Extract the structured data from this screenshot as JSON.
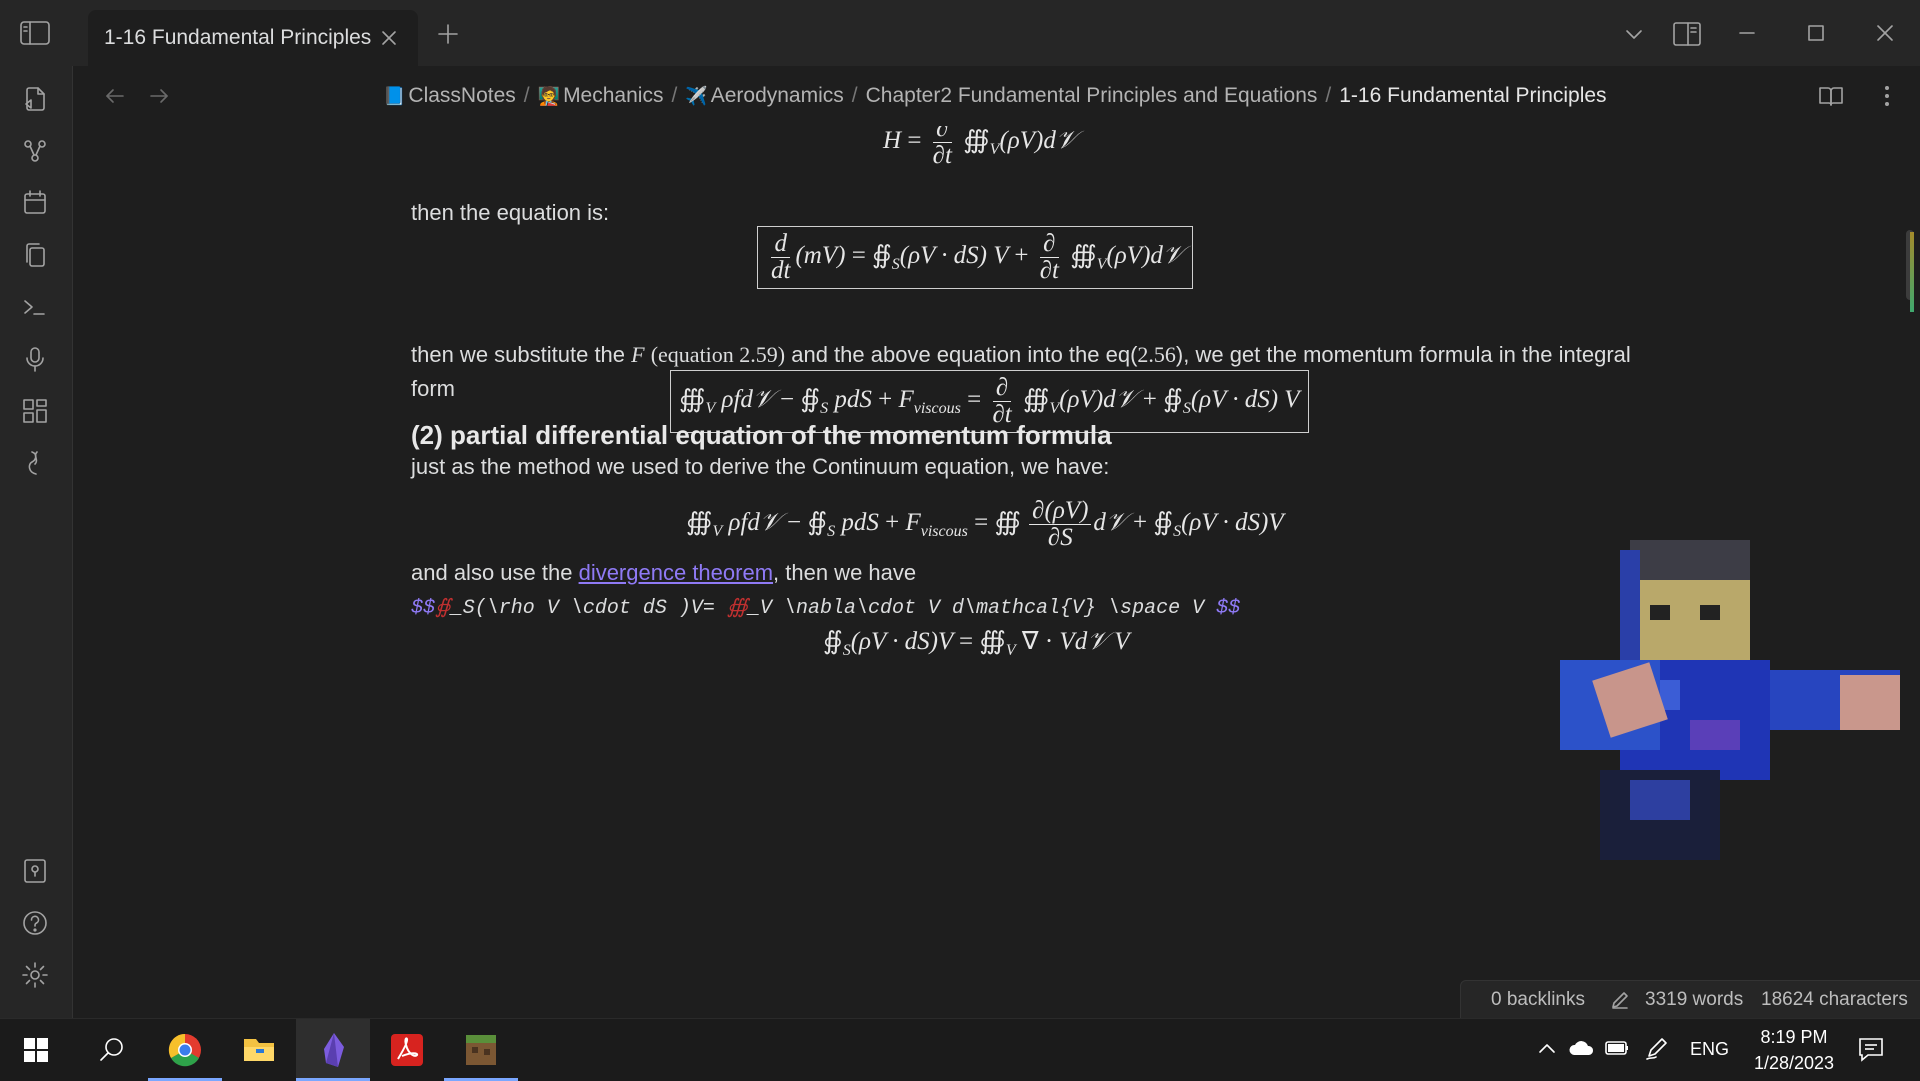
{
  "tab": {
    "title": "1-16 Fundamental Principles"
  },
  "breadcrumb": {
    "items": [
      "ClassNotes",
      "Mechanics",
      "Aerodynamics",
      "Chapter2 Fundamental Principles and Equations"
    ],
    "current": "1-16 Fundamental Principles",
    "emoji": [
      "📘",
      "🧑‍🏫",
      "✈️"
    ]
  },
  "note": {
    "math_H": "H = ∂/∂t ∰V(ρV)d𝒱",
    "p1": "then the equation is:",
    "p2_a": "then we substitute the ",
    "p2_F": "F",
    "p2_eqref": "(equation 2.59)",
    "p2_b": " and the above equation into the eq(",
    "p2_num": "2.56",
    "p2_c": "), we get the momentum formula in the integral form",
    "heading": "(2) partial differential equation of the momentum formula",
    "p3": "just as the method we used to derive the Continuum equation, we have:",
    "p4_a": "and also use the ",
    "p4_link": "divergence theorem",
    "p4_b": ", then we have",
    "raw_latex_open": "$$",
    "raw_latex_err1": "∯",
    "raw_latex_mid": "_S(\\rho V \\cdot dS )V=  ",
    "raw_latex_err2": "∰",
    "raw_latex_tail": "_V \\nabla\\cdot V d\\mathcal{V} \\space V ",
    "raw_latex_close": "$$"
  },
  "status": {
    "backlinks": "0 backlinks",
    "words": "3319 words",
    "characters": "18624 characters"
  },
  "taskbar": {
    "lang": "ENG",
    "time": "8:19 PM",
    "date": "1/28/2023"
  },
  "colors": {
    "accent": "#8f7af5",
    "error": "#c03030",
    "background": "#1e1e1e",
    "chrome": "#262626"
  },
  "icons": {
    "ribbon": [
      "open-file-icon",
      "graph-view-icon",
      "daily-note-icon",
      "copy-icon",
      "terminal-icon",
      "microphone-icon",
      "dashboard-icon",
      "tasks-icon",
      "vault-icon",
      "help-icon",
      "settings-icon"
    ],
    "taskbar": [
      "windows-start-icon",
      "search-icon",
      "chrome-icon",
      "file-explorer-icon",
      "obsidian-icon",
      "acrobat-icon",
      "minecraft-icon"
    ]
  }
}
